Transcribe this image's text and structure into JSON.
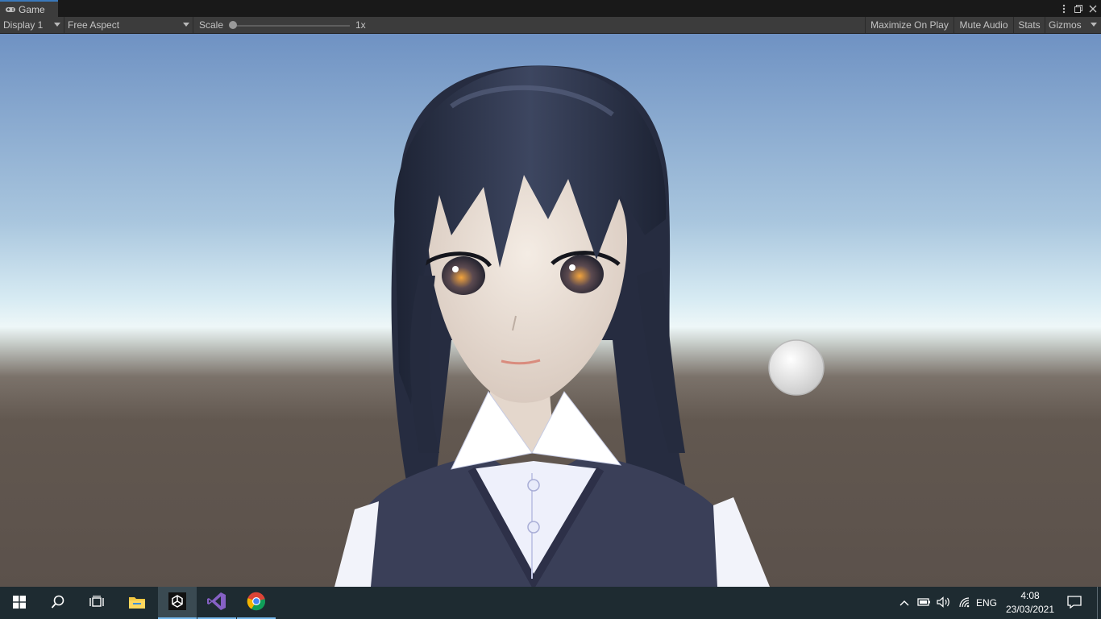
{
  "unity": {
    "tab": {
      "label": "Game",
      "icon": "gamepad-icon"
    },
    "toolbar": {
      "display": "Display 1",
      "aspect": "Free Aspect",
      "scale_label": "Scale",
      "scale_value": "1x",
      "maximize": "Maximize On Play",
      "mute": "Mute Audio",
      "stats": "Stats",
      "gizmos": "Gizmos"
    },
    "window_controls": [
      "more-icon",
      "maximize-icon",
      "close-icon"
    ]
  },
  "scene": {
    "description_icons": [
      "anime-character",
      "white-circle-button"
    ],
    "colors": {
      "sky_top": "#6f92c3",
      "horizon": "#e8f3f6",
      "ground": "#5e534c",
      "hair": "#2b3145",
      "vest": "#3a3f58"
    }
  },
  "taskbar": {
    "apps": [
      "windows-start-icon",
      "search-icon",
      "task-view-icon",
      "file-explorer-icon",
      "unity-icon",
      "visual-studio-icon",
      "chrome-icon"
    ],
    "tray": {
      "language": "ENG",
      "time": "4:08",
      "date": "23/03/2021",
      "icons": [
        "chevron-up-icon",
        "battery-icon",
        "volume-icon",
        "wifi-icon",
        "notification-icon"
      ]
    }
  }
}
